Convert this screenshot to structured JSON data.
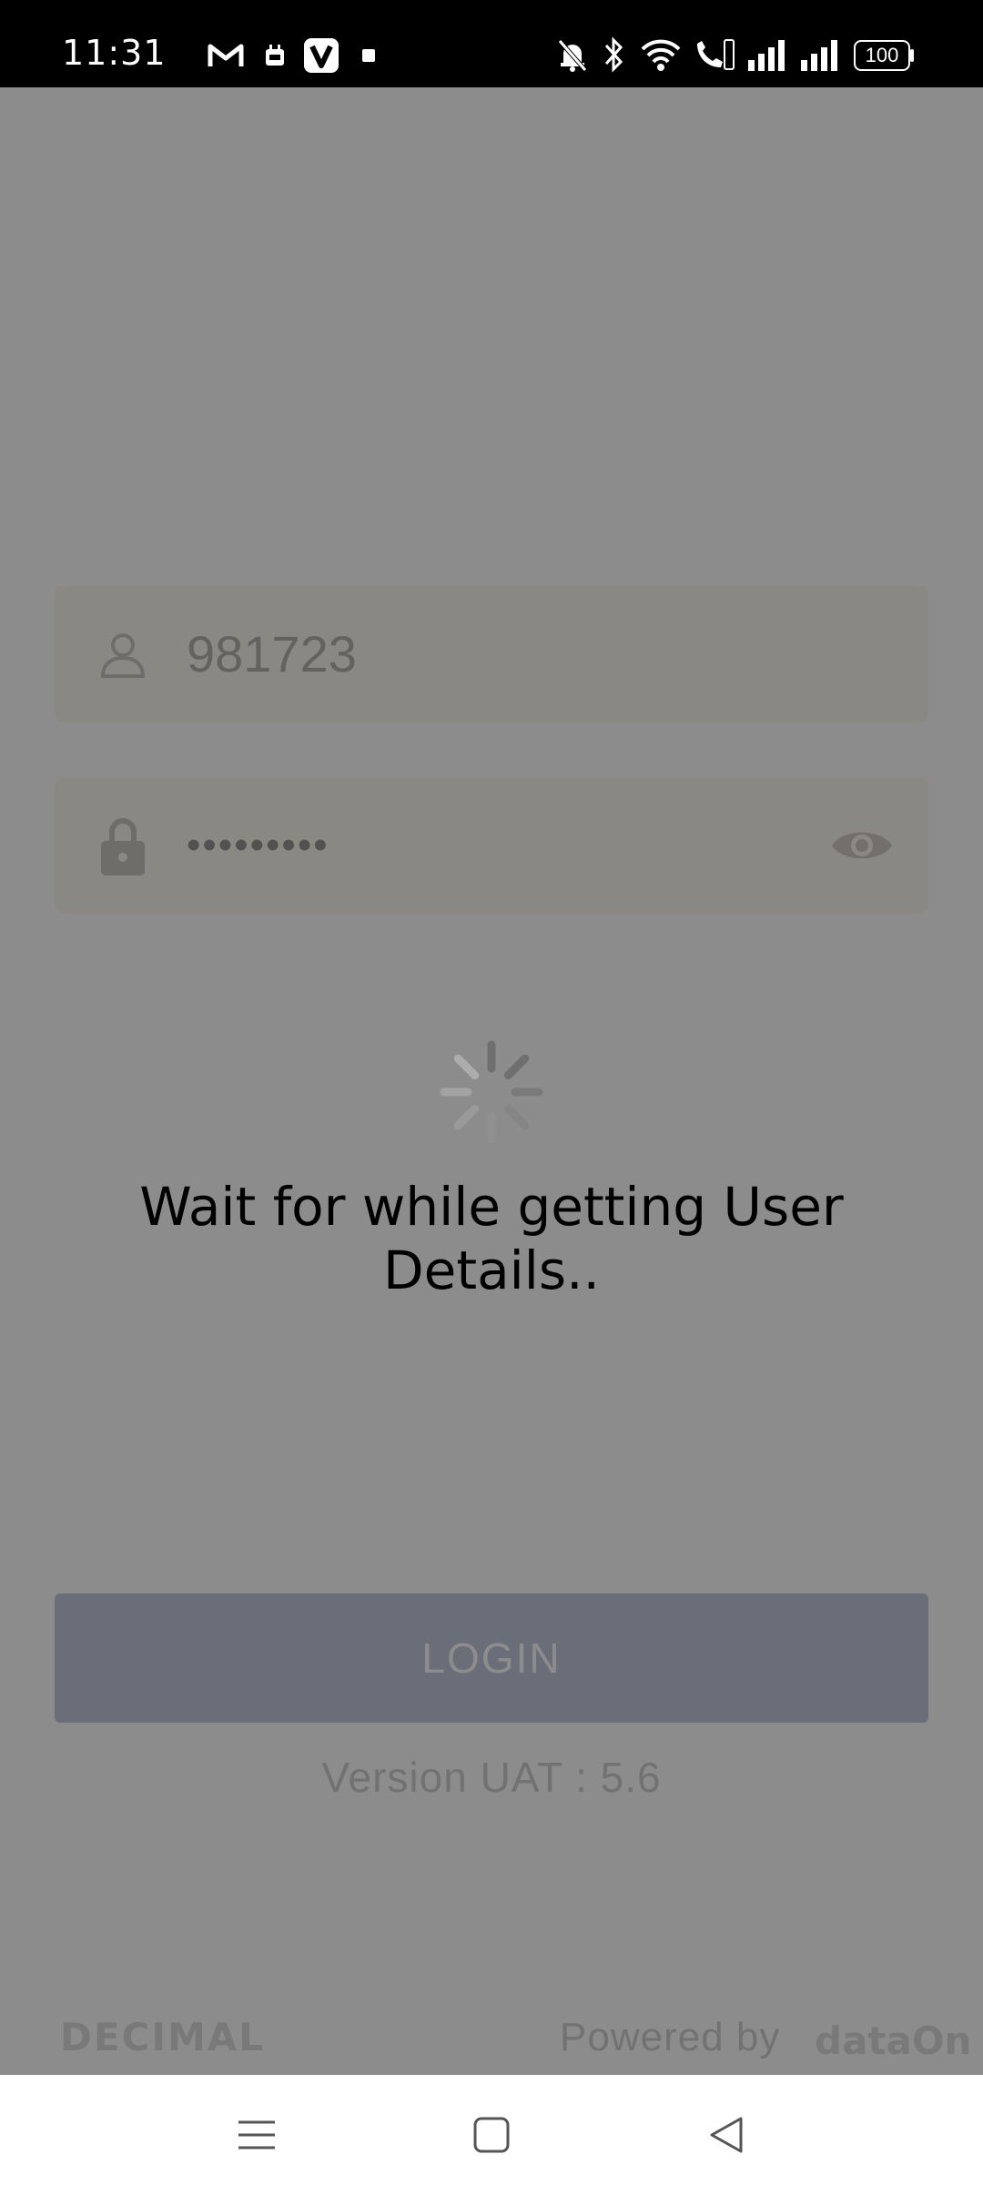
{
  "status_bar": {
    "time": "11:31",
    "battery": "100"
  },
  "login": {
    "username_value": "981723",
    "password_value": "•••••••••",
    "login_label": "LOGIN",
    "version": "Version UAT : 5.6"
  },
  "footer": {
    "brand": "DECIMAL",
    "powered_by": "Powered by",
    "partner": "dataOn"
  },
  "loading": {
    "message": "Wait for while getting User Details.."
  },
  "icons": {
    "status_left": [
      "gmail-icon",
      "calendar-icon",
      "app-v-icon",
      "dot-icon"
    ],
    "status_right": [
      "mute-icon",
      "bluetooth-icon",
      "wifi-icon",
      "wifi-call-icon",
      "signal-icon",
      "signal-icon",
      "battery-icon"
    ],
    "nav": [
      "menu-icon",
      "home-icon",
      "back-icon"
    ]
  }
}
